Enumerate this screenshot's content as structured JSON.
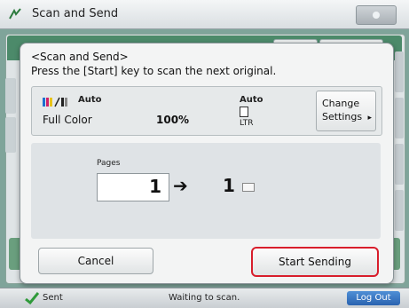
{
  "window": {
    "title": "Scan and Send"
  },
  "dialog": {
    "heading": "<Scan and Send>",
    "message": "Press the [Start] key to scan the next original.",
    "settings": {
      "color_auto": "Auto",
      "color_mode": "Full Color",
      "scale": "100%",
      "paper_auto": "Auto",
      "paper_size": "LTR",
      "change_line1": "Change",
      "change_line2": "Settings",
      "change_arrow": "▸"
    },
    "pages": {
      "label": "Pages",
      "count": "1",
      "arrow": "➔",
      "total": "1"
    },
    "buttons": {
      "cancel": "Cancel",
      "start_sending": "Start Sending"
    }
  },
  "status": {
    "sent_label": "Sent",
    "message": "Waiting to scan.",
    "logout_label": "Log Out"
  }
}
